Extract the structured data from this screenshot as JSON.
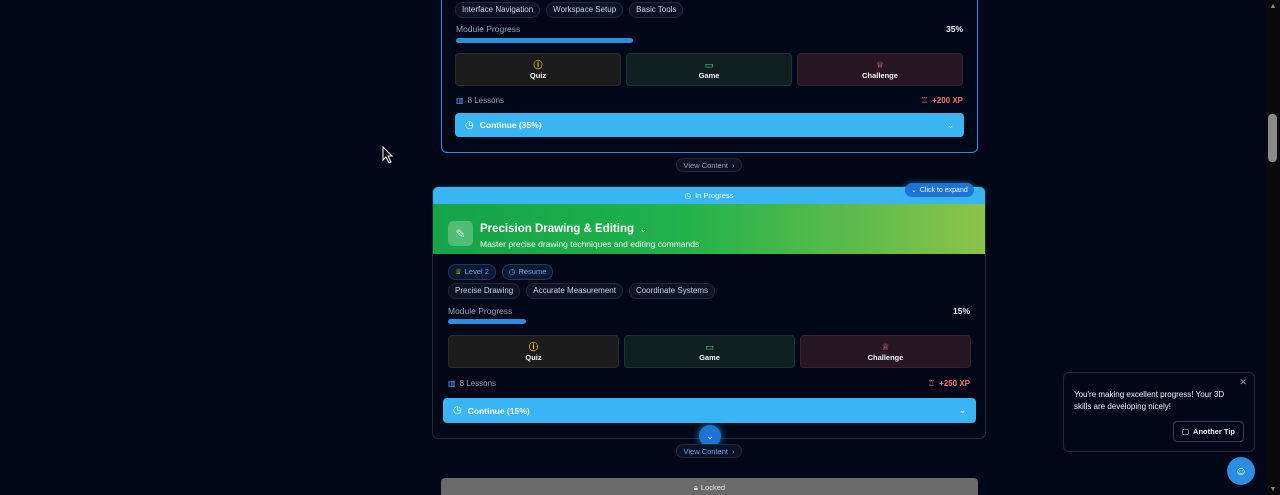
{
  "colors": {
    "background": "#020817",
    "accent": "#38b5f2",
    "card_border_active": "#2a8fe0",
    "hero_gradient_start": "#16a34a",
    "hero_gradient_end": "#8bc34a",
    "xp": "#f87171"
  },
  "module1": {
    "tags": [
      "Interface Navigation",
      "Workspace Setup",
      "Basic Tools"
    ],
    "progress_label": "Module Progress",
    "progress_text": "35%",
    "progress_value": 0.35,
    "activities": [
      {
        "label": "Quiz",
        "icon": "quiz-icon"
      },
      {
        "label": "Game",
        "icon": "gamepad-icon"
      },
      {
        "label": "Challenge",
        "icon": "trophy-icon"
      }
    ],
    "lessons": "8 Lessons",
    "xp": "+200 XP",
    "continue_label": "Continue (35%)",
    "view_content": "View Content"
  },
  "module2": {
    "status": "In Progress",
    "expand_hint": "Click to expand",
    "title": "Precision Drawing & Editing",
    "subtitle": "Master precise drawing techniques and editing commands",
    "level": "Level 2",
    "resume": "Resume",
    "tags": [
      "Precise Drawing",
      "Accurate Measurement",
      "Coordinate Systems"
    ],
    "progress_label": "Module Progress",
    "progress_text": "15%",
    "progress_value": 0.15,
    "activities": [
      {
        "label": "Quiz",
        "icon": "quiz-icon"
      },
      {
        "label": "Game",
        "icon": "gamepad-icon"
      },
      {
        "label": "Challenge",
        "icon": "trophy-icon"
      }
    ],
    "lessons": "8 Lessons",
    "xp": "+250 XP",
    "continue_label": "Continue (15%)",
    "view_content": "View Content"
  },
  "module3": {
    "status": "Locked"
  },
  "tip": {
    "text": "You're making excellent progress! Your 3D skills are developing nicely!",
    "button": "Another Tip"
  }
}
